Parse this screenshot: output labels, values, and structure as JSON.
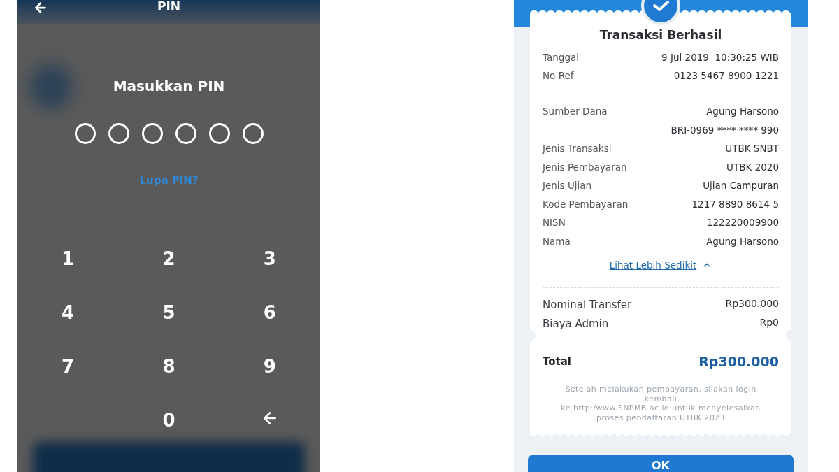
{
  "pin_screen": {
    "header": {
      "title": "PIN"
    },
    "prompt": "Masukkan PIN",
    "pin_dots": [
      {
        "filled": false
      },
      {
        "filled": false
      },
      {
        "filled": false
      },
      {
        "filled": false
      },
      {
        "filled": false
      },
      {
        "filled": false
      }
    ],
    "forgot_link": "Lupa PIN?",
    "keypad": [
      {
        "kind": "digit",
        "label": "1"
      },
      {
        "kind": "digit",
        "label": "2"
      },
      {
        "kind": "digit",
        "label": "3"
      },
      {
        "kind": "digit",
        "label": "4"
      },
      {
        "kind": "digit",
        "label": "5"
      },
      {
        "kind": "digit",
        "label": "6"
      },
      {
        "kind": "digit",
        "label": "7"
      },
      {
        "kind": "digit",
        "label": "8"
      },
      {
        "kind": "digit",
        "label": "9"
      },
      {
        "kind": "blank"
      },
      {
        "kind": "digit",
        "label": "0"
      },
      {
        "kind": "backspace"
      }
    ]
  },
  "receipt_screen": {
    "title": "Transaksi Berhasil",
    "details": [
      {
        "label": "Tanggal",
        "value": "9 Jul 2019  10:30:25 WIB"
      },
      {
        "label": "No Ref",
        "value": "0123 5467 8900 1221"
      }
    ],
    "more_details": [
      {
        "label": "Sumber Dana",
        "value": "Agung Harsono",
        "subvalue": "BRI-0969 **** **** 990"
      },
      {
        "label": "Jenis Transaksi",
        "value": "UTBK SNBT"
      },
      {
        "label": "Jenis Pembayaran",
        "value": "UTBK 2020"
      },
      {
        "label": "Jenis Ujian",
        "value": "Ujian Campuran"
      },
      {
        "label": "Kode Pembayaran",
        "value": "1217 8890 8614 5"
      },
      {
        "label": "NISN",
        "value": "122220009900"
      },
      {
        "label": "Nama",
        "value": "Agung Harsono"
      }
    ],
    "toggle_link": {
      "label": "Lihat Lebih Sedikit",
      "expanded": true
    },
    "charges": [
      {
        "label": "Nominal Transfer",
        "value": "Rp300.000"
      },
      {
        "label": "Biaya Admin",
        "value": "Rp0"
      }
    ],
    "total": {
      "label": "Total",
      "value": "Rp300.000"
    },
    "note_lines": [
      "Setelah melakukan pembayaran, silakan login kembali",
      "ke http:/www.SNPMB.ac.id untuk menyelesaikan proses pendaftaran UTBK 2023"
    ],
    "ok_button": "OK"
  }
}
